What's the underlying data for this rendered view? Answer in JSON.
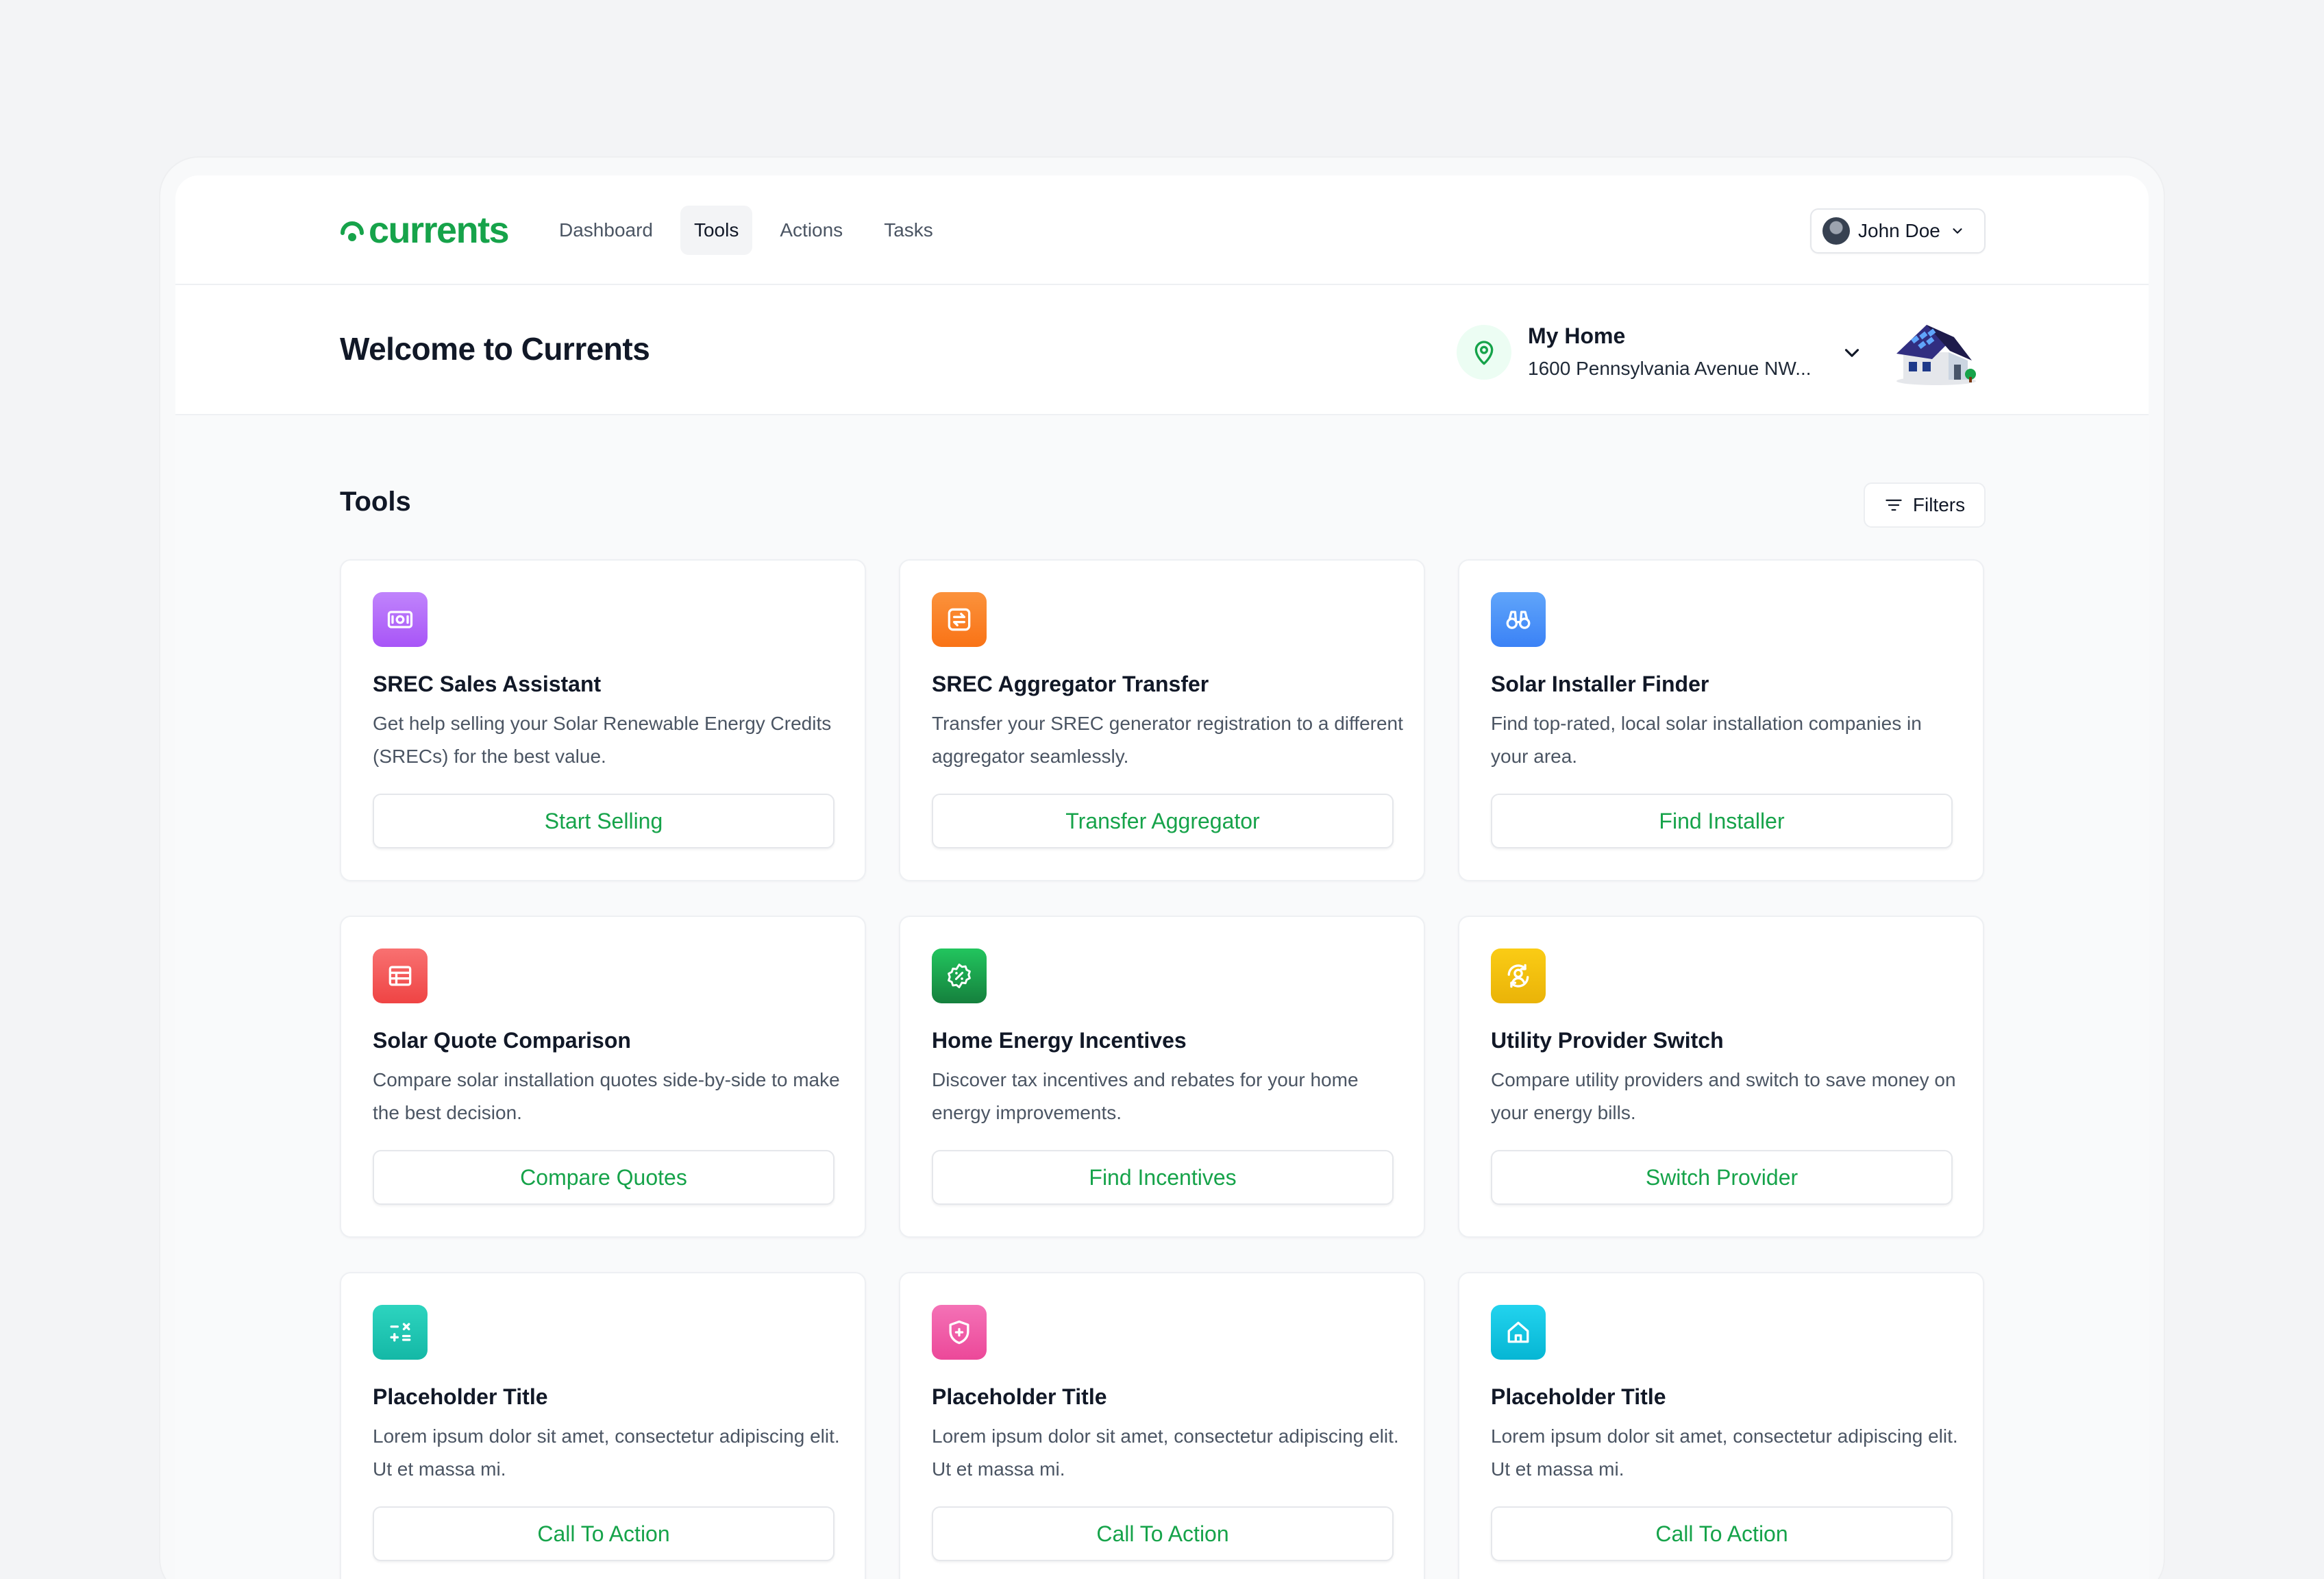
{
  "app": {
    "brand": "currents"
  },
  "nav": {
    "items": [
      {
        "label": "Dashboard",
        "active": false
      },
      {
        "label": "Tools",
        "active": true
      },
      {
        "label": "Actions",
        "active": false
      },
      {
        "label": "Tasks",
        "active": false
      }
    ]
  },
  "user": {
    "name": "John Doe"
  },
  "welcome": {
    "title": "Welcome to Currents"
  },
  "home": {
    "name": "My Home",
    "address": "1600 Pennsylvania Avenue NW..."
  },
  "tools": {
    "title": "Tools",
    "filters_label": "Filters",
    "cards": [
      {
        "title": "SREC Sales Assistant",
        "description": "Get help selling your Solar Renewable Energy Credits (SRECs) for the best value.",
        "cta": "Start Selling",
        "icon": "money-icon",
        "color": "#a855f7"
      },
      {
        "title": "SREC Aggregator Transfer",
        "description": "Transfer your SREC generator registration to a different aggregator seamlessly.",
        "cta": "Transfer Aggregator",
        "icon": "transfer-icon",
        "color": "#f97316"
      },
      {
        "title": "Solar Installer Finder",
        "description": "Find top-rated, local solar installation companies in your area.",
        "cta": "Find Installer",
        "icon": "binoculars-icon",
        "color": "#3b82f6"
      },
      {
        "title": "Solar Quote Comparison",
        "description": "Compare solar installation quotes side-by-side to make the best decision.",
        "cta": "Compare Quotes",
        "icon": "table-icon",
        "color": "#ef4444"
      },
      {
        "title": "Home Energy Incentives",
        "description": "Discover tax incentives and rebates for your home energy improvements.",
        "cta": "Find Incentives",
        "icon": "discount-badge-icon",
        "color": "#16a34a"
      },
      {
        "title": "Utility Provider Switch",
        "description": "Compare utility providers and switch to save money on your energy bills.",
        "cta": "Switch Provider",
        "icon": "user-switch-icon",
        "color": "#eab308"
      },
      {
        "title": "Placeholder Title",
        "description": "Lorem ipsum dolor sit amet, consectetur adipiscing elit. Ut et massa mi.",
        "cta": "Call To Action",
        "icon": "calculator-icon",
        "color": "#14b8a6"
      },
      {
        "title": "Placeholder Title",
        "description": "Lorem ipsum dolor sit amet, consectetur adipiscing elit. Ut et massa mi.",
        "cta": "Call To Action",
        "icon": "shield-plus-icon",
        "color": "#ec4899"
      },
      {
        "title": "Placeholder Title",
        "description": "Lorem ipsum dolor sit amet, consectetur adipiscing elit. Ut et massa mi.",
        "cta": "Call To Action",
        "icon": "home-icon",
        "color": "#06b6d4"
      }
    ]
  }
}
